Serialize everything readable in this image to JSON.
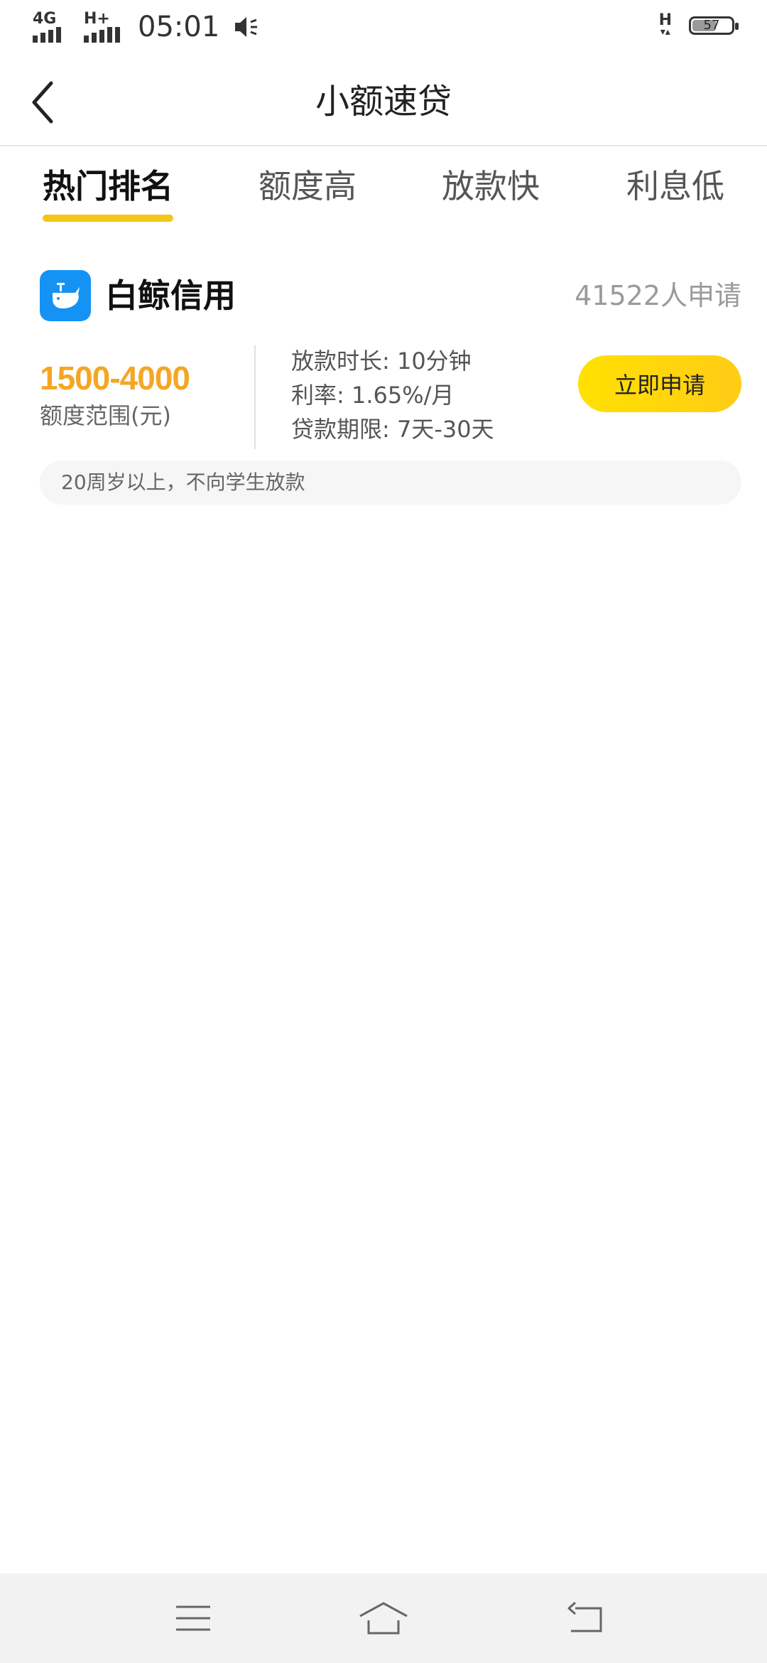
{
  "status_bar": {
    "network_1": "4G",
    "network_2": "H+",
    "time": "05:01",
    "network_right": "H",
    "battery_level": "57",
    "battery_fraction": 0.57
  },
  "header": {
    "title": "小额速贷"
  },
  "tabs": [
    {
      "label": "热门排名",
      "active": true
    },
    {
      "label": "额度高",
      "active": false
    },
    {
      "label": "放款快",
      "active": false
    },
    {
      "label": "利息低",
      "active": false
    }
  ],
  "colors": {
    "accent": "#f5c518",
    "amount": "#f5a623",
    "logo_bg": "#1593f5",
    "button_yellow": "#ffe100"
  },
  "loan": {
    "name": "白鲸信用",
    "applicants": "41522人申请",
    "amount_range": "1500-4000",
    "amount_label": "额度范围(元)",
    "details": [
      "放款时长: 10分钟",
      "利率: 1.65%/月",
      "贷款期限: 7天-30天"
    ],
    "apply_label": "立即申请",
    "notice": "20周岁以上，不向学生放款",
    "logo_icon": "whale-icon"
  },
  "nav": {
    "icons": [
      "menu-icon",
      "home-icon",
      "back-nav-icon"
    ]
  }
}
